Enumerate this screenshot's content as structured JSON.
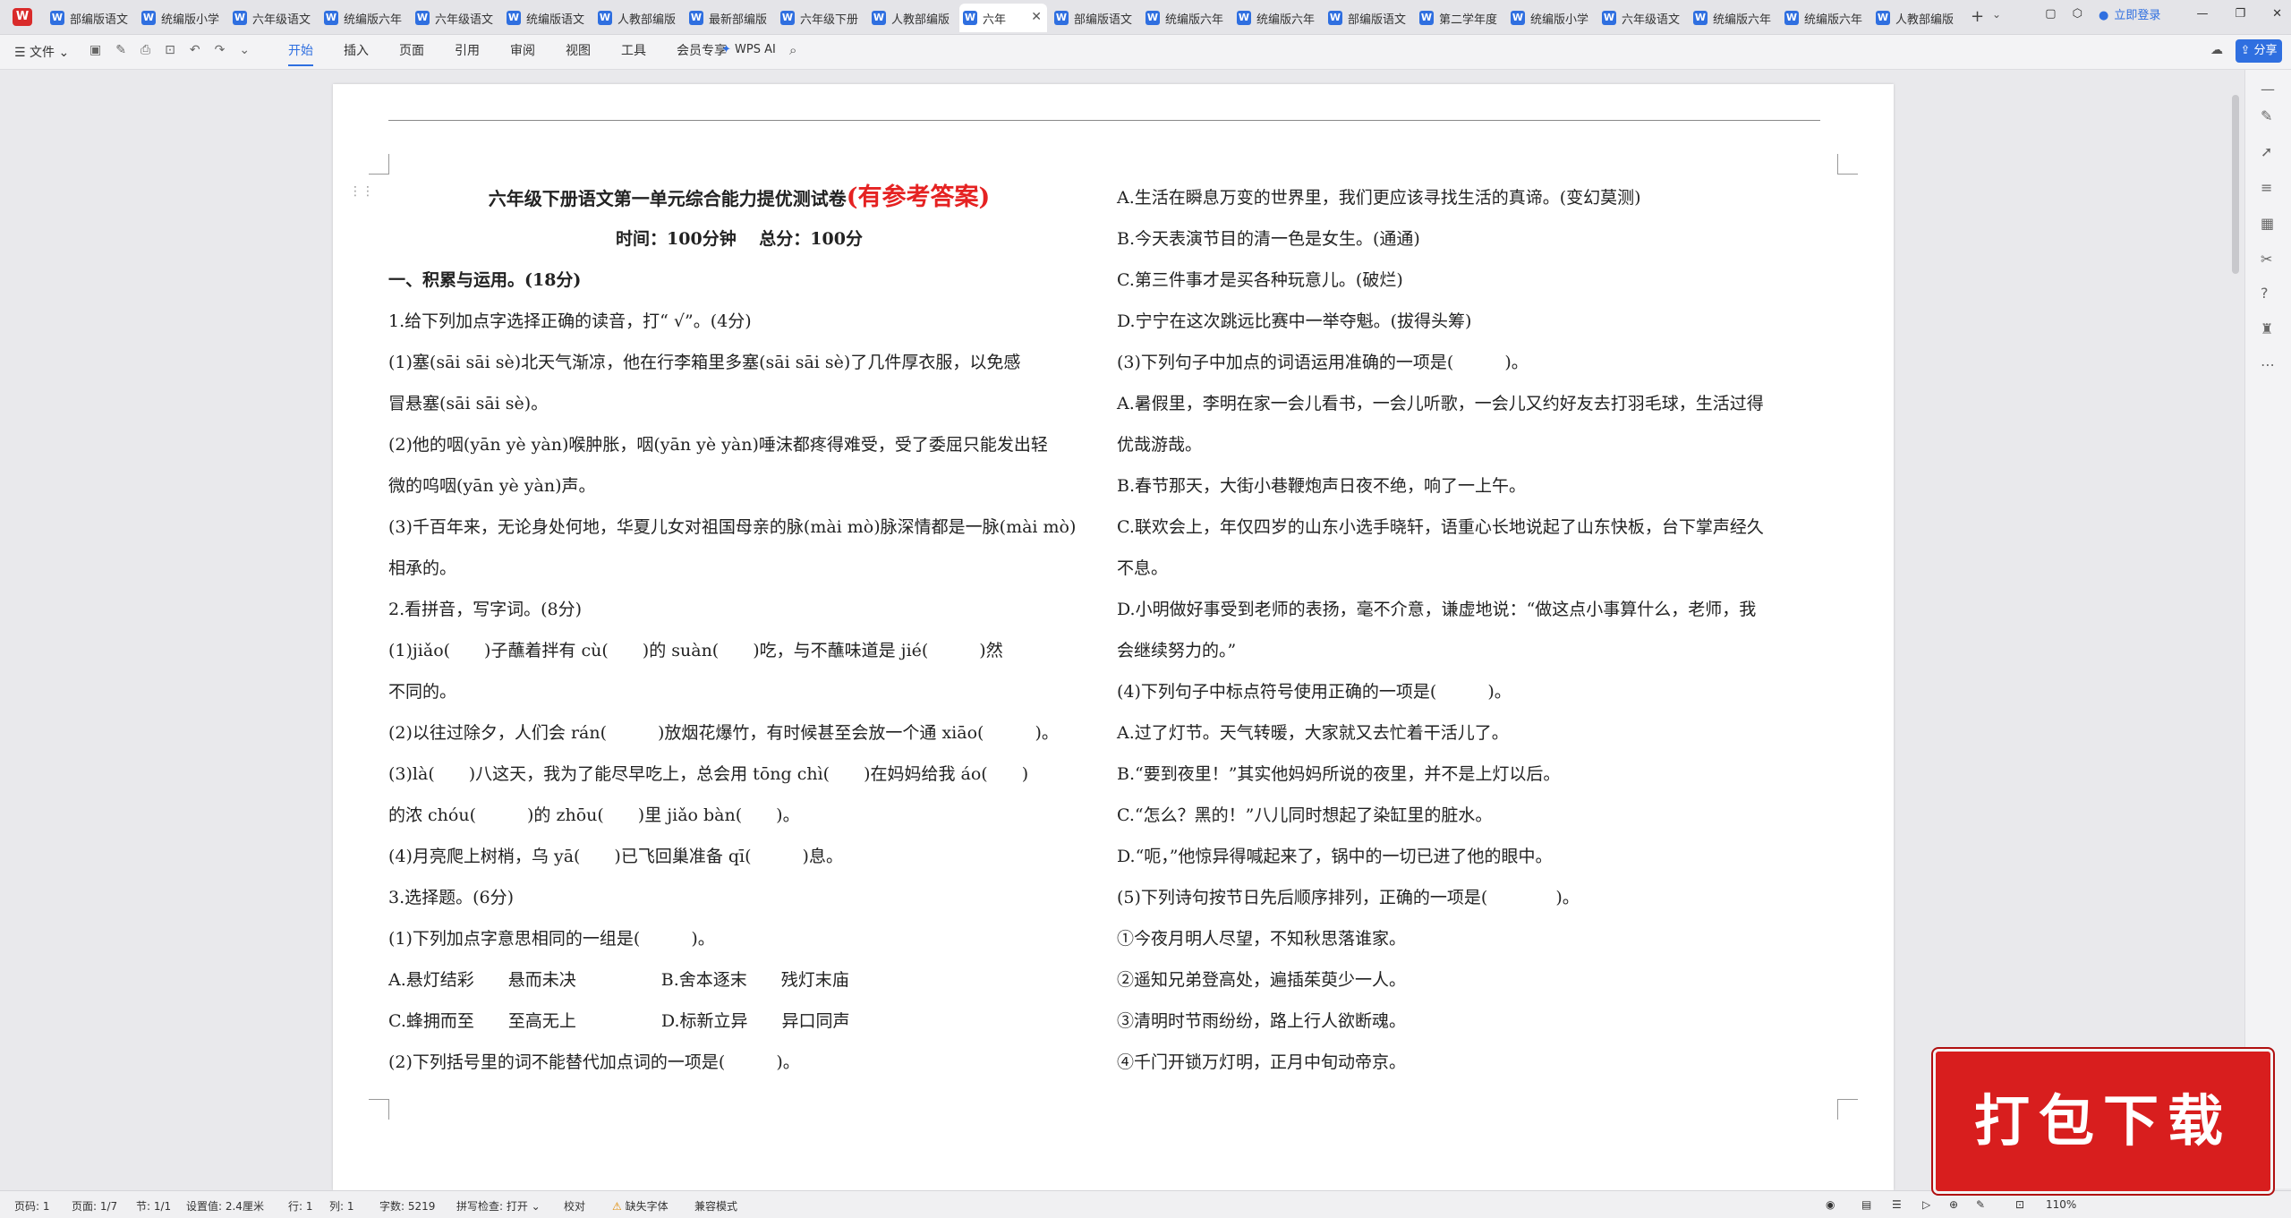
{
  "tabs": [
    {
      "label": "部编版语文"
    },
    {
      "label": "统编版小学"
    },
    {
      "label": "六年级语文"
    },
    {
      "label": "统编版六年"
    },
    {
      "label": "六年级语文"
    },
    {
      "label": "统编版语文"
    },
    {
      "label": "人教部编版"
    },
    {
      "label": "最新部编版"
    },
    {
      "label": "六年级下册"
    },
    {
      "label": "人教部编版"
    },
    {
      "label": "六年"
    },
    {
      "label": "部编版语文"
    },
    {
      "label": "统编版六年"
    },
    {
      "label": "统编版六年"
    },
    {
      "label": "部编版语文"
    },
    {
      "label": "第二学年度"
    },
    {
      "label": "统编版小学"
    },
    {
      "label": "六年级语文"
    },
    {
      "label": "统编版六年"
    },
    {
      "label": "统编版六年"
    },
    {
      "label": "人教部编版"
    }
  ],
  "topright": {
    "login": "立即登录"
  },
  "toolbar": {
    "file": "☰ 文件 ⌄",
    "ribbon": [
      "开始",
      "插入",
      "页面",
      "引用",
      "审阅",
      "视图",
      "工具",
      "会员专享"
    ],
    "wps_ai": "WPS AI",
    "share": "分享"
  },
  "doc": {
    "title": "六年级下册语文第一单元综合能力提优测试卷",
    "title_answer": "(有参考答案)",
    "subtitle": "时间：100分钟　 总分：100分",
    "left": [
      "一、积累与运用。(18分)",
      "1.给下列加点字选择正确的读音，打“ √”。(4分)",
      "(1)塞(sāi sāi sè)北天气渐凉，他在行李箱里多塞(sāi sāi sè)了几件厚衣服，以免感",
      "冒悬塞(sāi sāi sè)。",
      "(2)他的咽(yān yè yàn)喉肿胀，咽(yān yè yàn)唾沫都疼得难受，受了委屈只能发出轻",
      "微的呜咽(yān yè yàn)声。",
      "(3)千百年来，无论身处何地，华夏儿女对祖国母亲的脉(mài mò)脉深情都是一脉(mài mò)",
      "相承的。",
      "2.看拼音，写字词。(8分)",
      "(1)jiǎo(　　)子蘸着拌有 cù(　　)的 suàn(　　)吃，与不蘸味道是 jié(　　　)然",
      "不同的。",
      "(2)以往过除夕，人们会 rán(　　　)放烟花爆竹，有时候甚至会放一个通 xiāo(　　　)。",
      "(3)là(　　)八这天，我为了能尽早吃上，总会用 tōng chì(　　)在妈妈给我 áo(　　)",
      "的浓 chóu(　　　)的 zhōu(　　)里 jiǎo bàn(　　)。",
      "(4)月亮爬上树梢，乌 yā(　　)已飞回巢准备 qī(　　　)息。",
      "3.选择题。(6分)",
      "(1)下列加点字意思相同的一组是(　　　)。",
      "A.悬灯结彩　　悬而未决　　　　　B.舍本逐末　　残灯末庙",
      "C.蜂拥而至　　至高无上　　　　　D.标新立异　　异口同声",
      "(2)下列括号里的词不能替代加点词的一项是(　　　)。"
    ],
    "right": [
      "A.生活在瞬息万变的世界里，我们更应该寻找生活的真谛。(变幻莫测)",
      "B.今天表演节目的清一色是女生。(通通)",
      "C.第三件事才是买各种玩意儿。(破烂)",
      "D.宁宁在这次跳远比赛中一举夺魁。(拔得头筹)",
      "(3)下列句子中加点的词语运用准确的一项是(　　　)。",
      "A.暑假里，李明在家一会儿看书，一会儿听歌，一会儿又约好友去打羽毛球，生活过得",
      "优哉游哉。",
      "B.春节那天，大街小巷鞭炮声日夜不绝，响了一上午。",
      "C.联欢会上，年仅四岁的山东小选手晓轩，语重心长地说起了山东快板，台下掌声经久",
      "不息。",
      "D.小明做好事受到老师的表扬，毫不介意，谦虚地说：“做这点小事算什么，老师，我",
      "会继续努力的。”",
      "(4)下列句子中标点符号使用正确的一项是(　　　)。",
      "A.过了灯节。天气转暖，大家就又去忙着干活儿了。",
      "B.“要到夜里！”其实他妈妈所说的夜里，并不是上灯以后。",
      "C.“怎么？黑的！”八儿同时想起了染缸里的脏水。",
      "D.“呃，”他惊异得喊起来了，锅中的一切已进了他的眼中。",
      "(5)下列诗句按节日先后顺序排列，正确的一项是(　　　　)。",
      "①今夜月明人尽望，不知秋思落谁家。",
      "②遥知兄弟登高处，遍插茱萸少一人。",
      "③清明时节雨纷纷，路上行人欲断魂。",
      "④千门开锁万灯明，正月中旬动帝京。"
    ]
  },
  "status": {
    "page": "页码: 1",
    "pages": "页面: 1/7",
    "section": "节: 1/1",
    "setting": "设置值: 2.4厘米",
    "row": "行: 1",
    "col": "列: 1",
    "words": "字数: 5219",
    "spell": "拼写检查: 打开 ⌄",
    "proof": "校对",
    "missing_font": "缺失字体",
    "compat": "兼容模式",
    "zoom": "110%"
  },
  "banner": {
    "text": "打包下载"
  }
}
